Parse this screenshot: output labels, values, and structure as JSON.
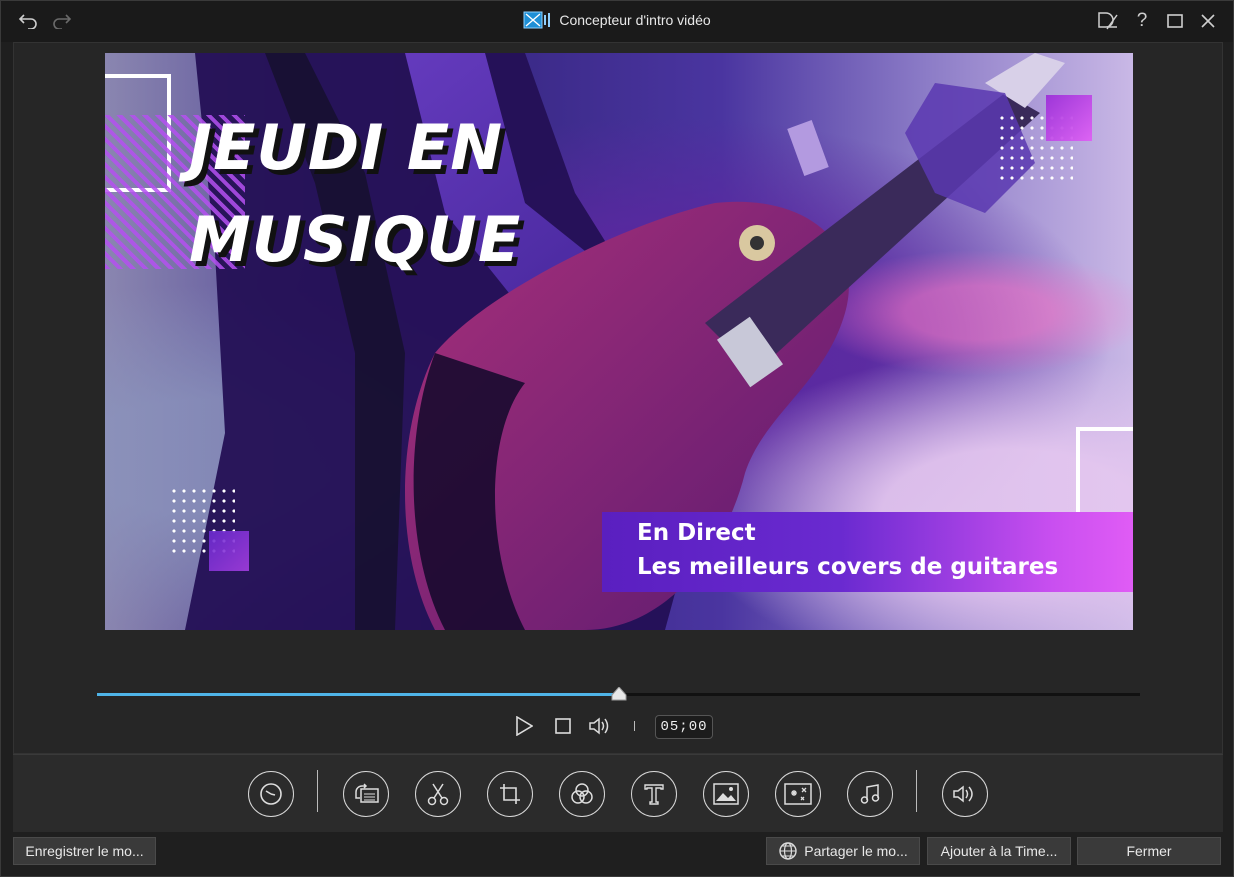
{
  "window": {
    "title": "Concepteur d'intro vidéo"
  },
  "preview": {
    "title_line1": "JEUDI EN",
    "title_line2": "MUSIQUE",
    "subtitle_line1": "En Direct",
    "subtitle_line2": "Les meilleurs covers de guitares"
  },
  "player": {
    "timecode": "05;00",
    "progress_percent": 50
  },
  "buttons": {
    "save": "Enregistrer le mo...",
    "share": "Partager le mo...",
    "add_timeline": "Ajouter à la Time...",
    "close": "Fermer"
  },
  "colors": {
    "accent": "#4fb4e8",
    "band_start": "#5a1fc0",
    "band_end": "#e05cf5"
  }
}
